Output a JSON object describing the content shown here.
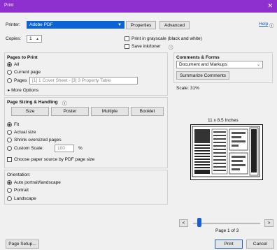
{
  "window": {
    "title": "Print",
    "close": "✕"
  },
  "printer": {
    "label": "Printer:",
    "value": "Adobe PDF",
    "properties": "Properties",
    "advanced": "Advanced",
    "help": "Help",
    "help_icon": "ⓘ"
  },
  "copies": {
    "label": "Copies:",
    "value": "1"
  },
  "options": {
    "grayscale": "Print in grayscale (black and white)",
    "save_ink": "Save ink/toner"
  },
  "pages_to_print": {
    "heading": "Pages to Print",
    "all": "All",
    "current": "Current page",
    "pages": "Pages",
    "pages_value": "[1] 1 Cover Sheet - [3] 3 Property Table",
    "more": "More Options"
  },
  "sizing": {
    "heading": "Page Sizing & Handling",
    "tabs": [
      "Size",
      "Poster",
      "Multiple",
      "Booklet"
    ],
    "fit": "Fit",
    "actual": "Actual size",
    "shrink": "Shrink oversized pages",
    "custom": "Custom Scale:",
    "custom_value": "100",
    "custom_unit": "%",
    "paper_source": "Choose paper source by PDF page size"
  },
  "orientation": {
    "heading": "Orientation:",
    "auto": "Auto portrait/landscape",
    "portrait": "Portrait",
    "landscape": "Landscape"
  },
  "comments": {
    "heading": "Comments & Forms",
    "value": "Document and Markups",
    "summarize": "Summarize Comments"
  },
  "preview": {
    "scale": "Scale: 31%",
    "paper": "11 x 8.5 Inches",
    "page": "Page 1 of 3",
    "prev": "<",
    "next": ">"
  },
  "footer": {
    "setup": "Page Setup...",
    "print": "Print",
    "cancel": "Cancel"
  }
}
